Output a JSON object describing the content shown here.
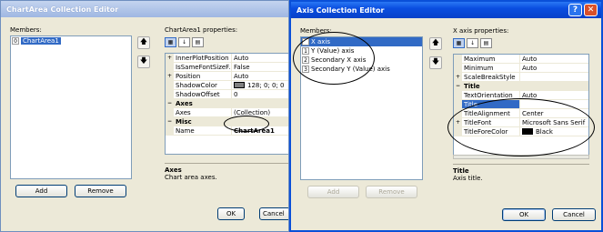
{
  "w1": {
    "title": "ChartArea Collection Editor",
    "members_label": "Members:",
    "members": [
      {
        "idx": "0",
        "label": "ChartArea1"
      }
    ],
    "props_label": "ChartArea1 properties:",
    "grid": [
      {
        "m": "+",
        "n": "InnerPlotPosition",
        "v": "Auto"
      },
      {
        "m": "",
        "n": "IsSameFontSizeF...",
        "v": "False"
      },
      {
        "m": "+",
        "n": "Position",
        "v": "Auto"
      },
      {
        "m": "",
        "n": "ShadowColor",
        "v": "128; 0; 0; 0",
        "swatch": "#808080"
      },
      {
        "m": "",
        "n": "ShadowOffset",
        "v": "0"
      },
      {
        "cat": true,
        "m": "−",
        "n": "Axes"
      },
      {
        "m": "",
        "n": "Axes",
        "v": "(Collection)"
      },
      {
        "cat": true,
        "m": "−",
        "n": "Misc"
      },
      {
        "m": "",
        "n": "Name",
        "v": "ChartArea1",
        "bold": true
      }
    ],
    "help_title": "Axes",
    "help_desc": "Chart area axes.",
    "add": "Add",
    "remove": "Remove",
    "ok": "OK",
    "cancel": "Cancel",
    "up_arrow": "🡅",
    "down_arrow": "🡇"
  },
  "w2": {
    "title": "Axis Collection Editor",
    "help_btn": "?",
    "close_btn": "✕",
    "members_label": "Members:",
    "members": [
      {
        "idx": "0",
        "label": "X axis",
        "sel": true
      },
      {
        "idx": "1",
        "label": "Y (Value) axis"
      },
      {
        "idx": "2",
        "label": "Secondary X axis"
      },
      {
        "idx": "3",
        "label": "Secondary Y (Value) axis"
      }
    ],
    "props_label": "X axis properties:",
    "grid": [
      {
        "m": "",
        "n": "Maximum",
        "v": "Auto"
      },
      {
        "m": "",
        "n": "Minimum",
        "v": "Auto"
      },
      {
        "m": "+",
        "n": "ScaleBreakStyle",
        "v": ""
      },
      {
        "cat": true,
        "m": "−",
        "n": "Title"
      },
      {
        "m": "",
        "n": "TextOrientation",
        "v": "Auto"
      },
      {
        "m": "",
        "n": "Title",
        "v": "",
        "sel": true
      },
      {
        "m": "",
        "n": "TitleAlignment",
        "v": "Center"
      },
      {
        "m": "+",
        "n": "TitleFont",
        "v": "Microsoft Sans Serif"
      },
      {
        "m": "",
        "n": "TitleForeColor",
        "v": "Black",
        "swatch": "#000000"
      }
    ],
    "help_title": "Title",
    "help_desc": "Axis title.",
    "add": "Add",
    "remove": "Remove",
    "ok": "OK",
    "cancel": "Cancel",
    "up_arrow": "🡅",
    "down_arrow": "🡇"
  },
  "toolbar_icons": [
    "categorized-icon",
    "alphabetical-icon",
    "property-pages-icon"
  ]
}
